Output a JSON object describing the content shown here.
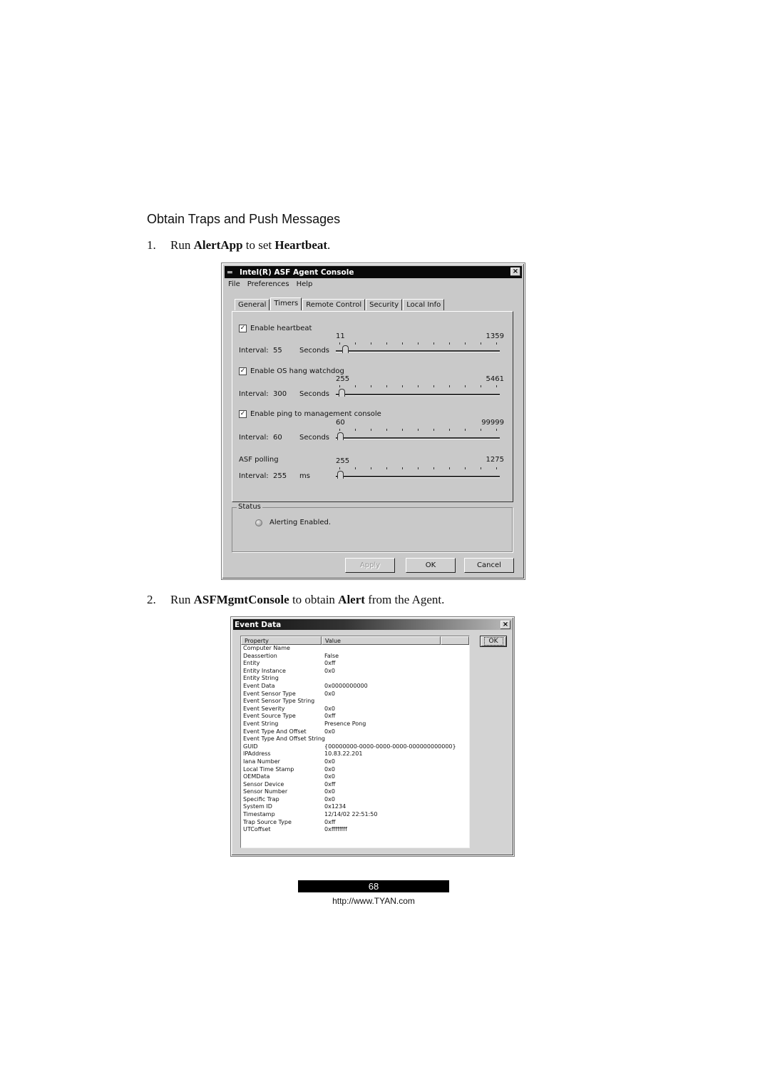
{
  "section_heading": "Obtain Traps and Push Messages",
  "steps": [
    {
      "number": "1.",
      "pre": "Run ",
      "b1": "AlertApp",
      "mid": " to set ",
      "b2": "Heartbeat",
      "post": "."
    },
    {
      "number": "2.",
      "pre": "Run ",
      "b1": "ASFMgmtConsole",
      "mid": " to obtain ",
      "b2": "Alert",
      "post": " from the Agent."
    }
  ],
  "agent_console": {
    "title": "Intel(R) ASF Agent Console",
    "close_icon": "×",
    "menu": [
      "File",
      "Preferences",
      "Help"
    ],
    "tabs": [
      {
        "label": "General",
        "active": false
      },
      {
        "label": "Timers",
        "active": true
      },
      {
        "label": "Remote Control",
        "active": false
      },
      {
        "label": "Security",
        "active": false
      },
      {
        "label": "Local Info",
        "active": false
      }
    ],
    "timers": [
      {
        "checkbox_label": "Enable heartbeat",
        "checked": true,
        "interval_label": "Interval:",
        "value": "55",
        "unit": "Seconds",
        "min": "11",
        "max": "1359",
        "slider_fraction": 0.033
      },
      {
        "checkbox_label": "Enable OS hang watchdog",
        "checked": true,
        "interval_label": "Interval:",
        "value": "300",
        "unit": "Seconds",
        "min": "255",
        "max": "5461",
        "slider_fraction": 0.009
      },
      {
        "checkbox_label": "Enable ping to management console",
        "checked": true,
        "interval_label": "Interval:",
        "value": "60",
        "unit": "Seconds",
        "min": "60",
        "max": "99999",
        "slider_fraction": 0.0
      },
      {
        "checkbox_label": "ASF polling",
        "checked": null,
        "interval_label": "Interval:",
        "value": "255",
        "unit": "ms",
        "min": "255",
        "max": "1275",
        "slider_fraction": 0.0
      }
    ],
    "status": {
      "legend": "Status",
      "text": "Alerting Enabled."
    },
    "buttons": {
      "apply": "Apply",
      "ok": "OK",
      "cancel": "Cancel"
    },
    "check_glyph": "✓"
  },
  "event_data": {
    "title": "Event Data",
    "close_icon": "×",
    "columns": [
      "Property",
      "Value",
      ""
    ],
    "ok_label": "OK",
    "rows": [
      {
        "property": "Computer Name",
        "value": ""
      },
      {
        "property": "Deassertion",
        "value": "False"
      },
      {
        "property": "Entity",
        "value": "0xff"
      },
      {
        "property": "Entity Instance",
        "value": "0x0"
      },
      {
        "property": "Entity String",
        "value": ""
      },
      {
        "property": "Event Data",
        "value": "0x0000000000"
      },
      {
        "property": "Event Sensor Type",
        "value": "0x0"
      },
      {
        "property": "Event Sensor Type String",
        "value": ""
      },
      {
        "property": "Event Severity",
        "value": "0x0"
      },
      {
        "property": "Event Source Type",
        "value": "0xff"
      },
      {
        "property": "Event String",
        "value": "Presence Pong"
      },
      {
        "property": "Event Type And Offset",
        "value": "0x0"
      },
      {
        "property": "Event Type And Offset String",
        "value": ""
      },
      {
        "property": "GUID",
        "value": "{00000000-0000-0000-0000-000000000000}"
      },
      {
        "property": "IPAddress",
        "value": "10.83.22.201"
      },
      {
        "property": "Iana Number",
        "value": "0x0"
      },
      {
        "property": "Local Time Stamp",
        "value": "0x0"
      },
      {
        "property": "OEMData",
        "value": "0x0"
      },
      {
        "property": "Sensor Device",
        "value": "0xff"
      },
      {
        "property": "Sensor Number",
        "value": "0x0"
      },
      {
        "property": "Specific Trap",
        "value": "0x0"
      },
      {
        "property": "System ID",
        "value": "0x1234"
      },
      {
        "property": "Timestamp",
        "value": "12/14/02 22:51:50"
      },
      {
        "property": "Trap Source Type",
        "value": "0xff"
      },
      {
        "property": "UTCoffset",
        "value": "0xffffffff"
      }
    ]
  },
  "footer": {
    "page_number": "68",
    "url": "http://www.TYAN.com"
  }
}
